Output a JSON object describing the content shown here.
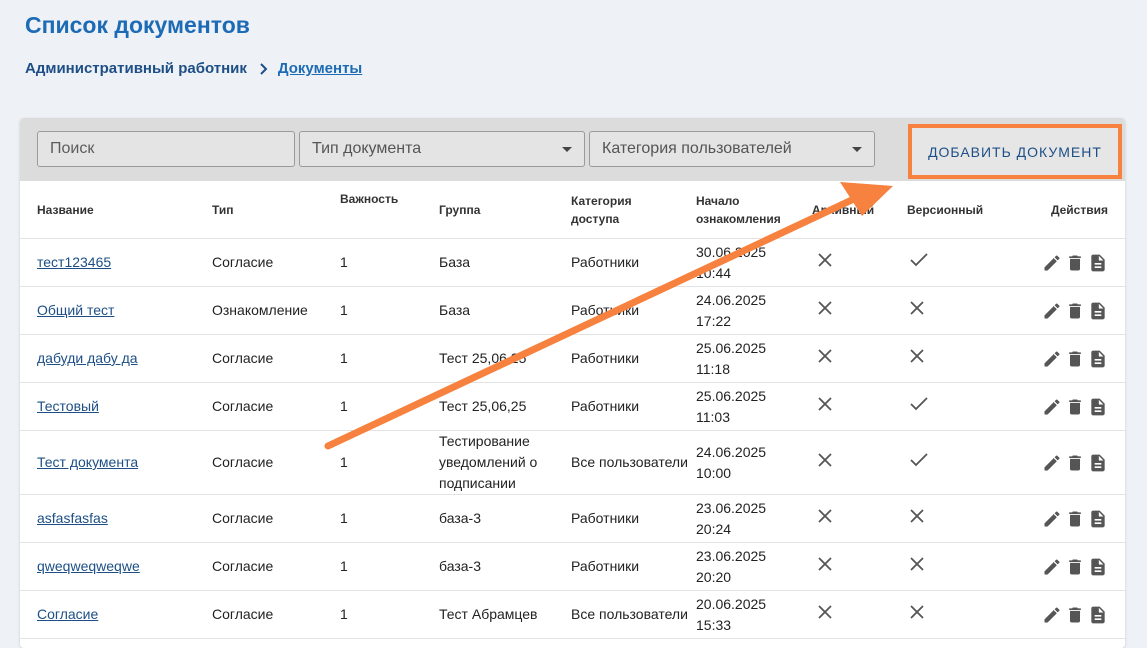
{
  "page": {
    "title": "Список документов",
    "breadcrumb": {
      "parent": "Административный работник",
      "current": "Документы"
    }
  },
  "toolbar": {
    "search_placeholder": "Поиск",
    "doc_type_label": "Тип документа",
    "user_category_label": "Категория пользователей",
    "add_button_label": "ДОБАВИТЬ ДОКУМЕНТ"
  },
  "table": {
    "headers": {
      "name": "Название",
      "type": "Тип",
      "importance": "Важность",
      "group": "Группа",
      "category": "Категория доступа",
      "start": "Начало ознакомления",
      "archived": "Архивный",
      "versioned": "Версионный",
      "actions": "Действия"
    },
    "rows": [
      {
        "name": "тест123465",
        "type": "Согласие",
        "importance": "1",
        "group": "База",
        "category": "Работники",
        "start_date": "30.06.2025",
        "start_time": "10:44",
        "archived": "x-icon",
        "versioned": "check-icon"
      },
      {
        "name": "Общий тест",
        "type": "Ознакомление",
        "importance": "1",
        "group": "База",
        "category": "Работники",
        "start_date": "24.06.2025",
        "start_time": "17:22",
        "archived": "x-icon",
        "versioned": "x-icon"
      },
      {
        "name": "дабуди дабу да",
        "type": "Согласие",
        "importance": "1",
        "group": "Тест 25,06,25",
        "category": "Работники",
        "start_date": "25.06.2025",
        "start_time": "11:18",
        "archived": "x-icon",
        "versioned": "x-icon"
      },
      {
        "name": "Тестовый",
        "type": "Согласие",
        "importance": "1",
        "group": "Тест 25,06,25",
        "category": "Работники",
        "start_date": "25.06.2025",
        "start_time": "11:03",
        "archived": "x-icon",
        "versioned": "check-icon"
      },
      {
        "name": "Тест документа",
        "type": "Согласие",
        "importance": "1",
        "group": "Тестирование уведомлений о подписании",
        "category": "Все пользователи",
        "start_date": "24.06.2025",
        "start_time": "10:00",
        "archived": "x-icon",
        "versioned": "check-icon"
      },
      {
        "name": "asfasfasfas",
        "type": "Согласие",
        "importance": "1",
        "group": "база-3",
        "category": "Работники",
        "start_date": "23.06.2025",
        "start_time": "20:24",
        "archived": "x-icon",
        "versioned": "x-icon"
      },
      {
        "name": "qweqweqweqwe",
        "type": "Согласие",
        "importance": "1",
        "group": "база-3",
        "category": "Работники",
        "start_date": "23.06.2025",
        "start_time": "20:20",
        "archived": "x-icon",
        "versioned": "x-icon"
      },
      {
        "name": "Согласие",
        "type": "Согласие",
        "importance": "1",
        "group": "Тест Абрамцев",
        "category": "Все пользователи",
        "start_date": "20.06.2025",
        "start_time": "15:33",
        "archived": "x-icon",
        "versioned": "x-icon"
      }
    ]
  },
  "colors": {
    "accent": "#1d6bb5",
    "highlight": "#f7813e",
    "background": "#eef2f6"
  }
}
